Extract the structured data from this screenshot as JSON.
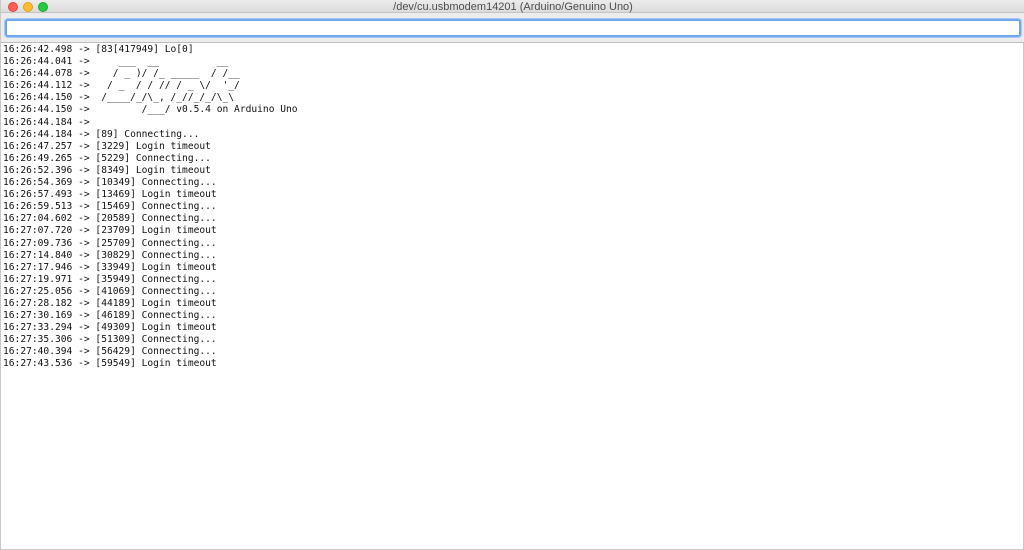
{
  "window": {
    "title": "/dev/cu.usbmodem14201 (Arduino/Genuino Uno)"
  },
  "input": {
    "value": "",
    "placeholder": ""
  },
  "log": [
    "16:26:42.498 -> [83[417949] Lo[0]",
    "16:26:44.041 ->     ___  __          __",
    "16:26:44.078 ->    / _ )/ /_ _____  / /__",
    "16:26:44.112 ->   / _  / / // / _ \\/  '_/",
    "16:26:44.150 ->  /____/_/\\_, /_//_/_/\\_\\",
    "16:26:44.150 ->         /___/ v0.5.4 on Arduino Uno",
    "16:26:44.184 ->",
    "16:26:44.184 -> [89] Connecting...",
    "16:26:47.257 -> [3229] Login timeout",
    "16:26:49.265 -> [5229] Connecting...",
    "16:26:52.396 -> [8349] Login timeout",
    "16:26:54.369 -> [10349] Connecting...",
    "16:26:57.493 -> [13469] Login timeout",
    "16:26:59.513 -> [15469] Connecting...",
    "16:27:04.602 -> [20589] Connecting...",
    "16:27:07.720 -> [23709] Login timeout",
    "16:27:09.736 -> [25709] Connecting...",
    "16:27:14.840 -> [30829] Connecting...",
    "16:27:17.946 -> [33949] Login timeout",
    "16:27:19.971 -> [35949] Connecting...",
    "16:27:25.056 -> [41069] Connecting...",
    "16:27:28.182 -> [44189] Login timeout",
    "16:27:30.169 -> [46189] Connecting...",
    "16:27:33.294 -> [49309] Login timeout",
    "16:27:35.306 -> [51309] Connecting...",
    "16:27:40.394 -> [56429] Connecting...",
    "16:27:43.536 -> [59549] Login timeout"
  ]
}
